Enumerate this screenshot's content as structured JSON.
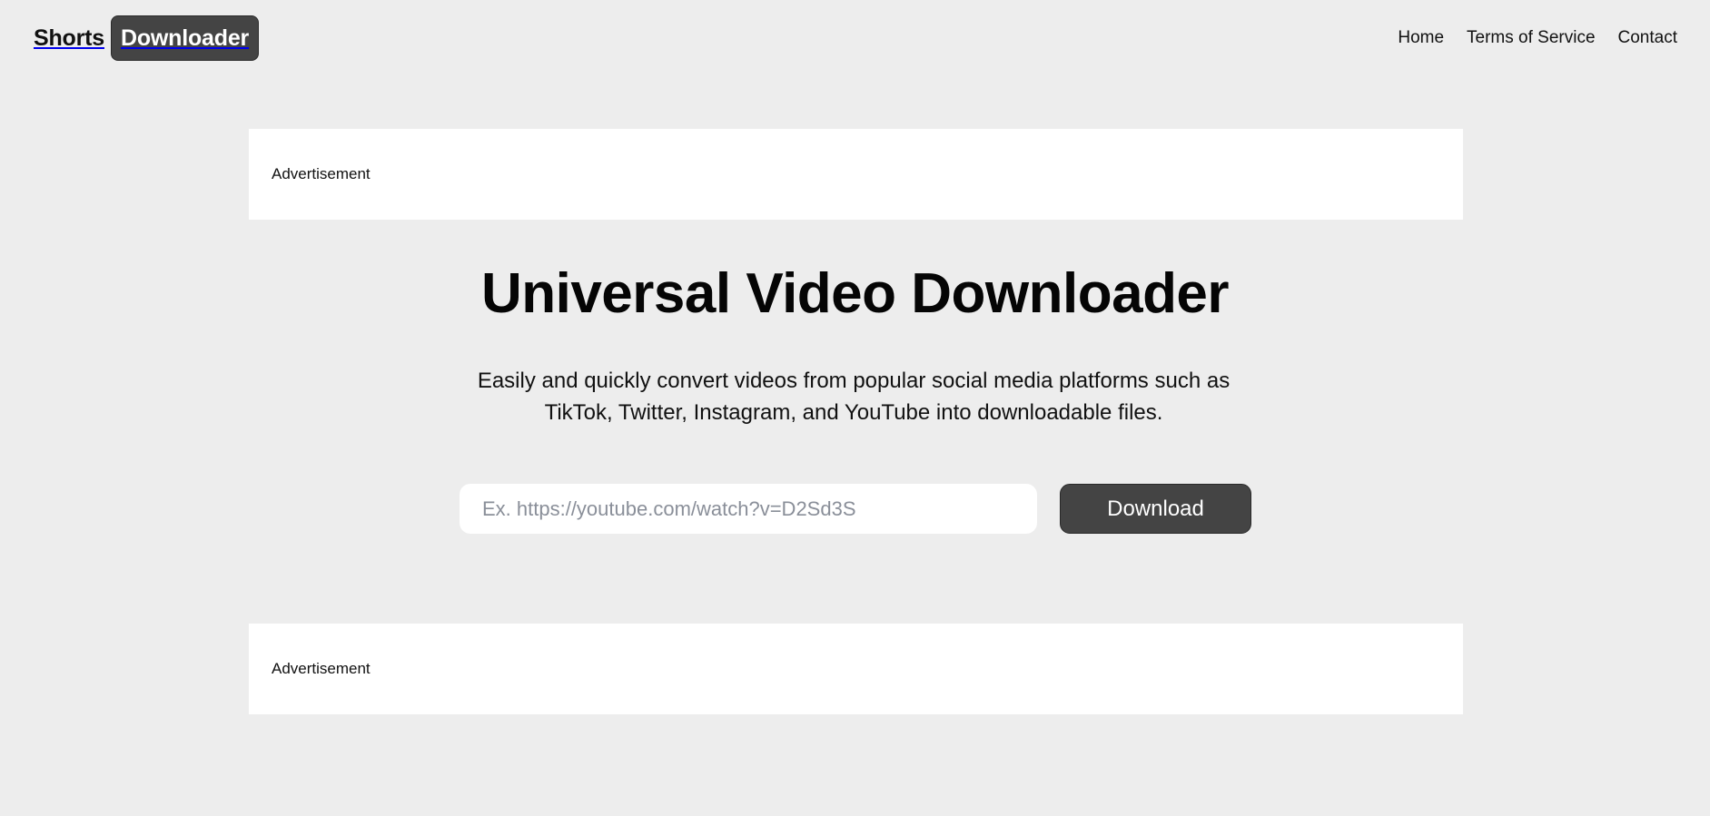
{
  "header": {
    "brand_text": "Shorts",
    "brand_badge": "Downloader",
    "nav": [
      {
        "label": "Home"
      },
      {
        "label": "Terms of Service"
      },
      {
        "label": "Contact"
      }
    ]
  },
  "ads": {
    "top_label": "Advertisement",
    "bottom_label": "Advertisement"
  },
  "hero": {
    "title": "Universal Video Downloader",
    "subtitle": "Easily and quickly convert videos from popular social media platforms such as TikTok, Twitter, Instagram, and YouTube into downloadable files."
  },
  "form": {
    "url_value": "",
    "url_placeholder": "Ex. https://youtube.com/watch?v=D2Sd3S",
    "download_label": "Download"
  },
  "colors": {
    "background": "#ededed",
    "accent_dark": "#444444",
    "surface": "#ffffff"
  }
}
